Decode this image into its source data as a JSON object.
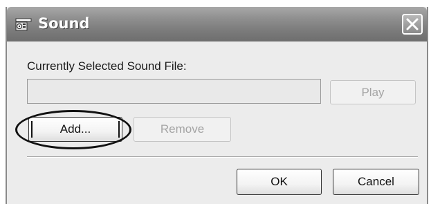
{
  "window": {
    "title": "Sound",
    "title_icon": "sound-speaker-icon",
    "close_icon": "close-icon"
  },
  "content": {
    "current_file_label": "Currently Selected Sound File:",
    "current_file_value": ""
  },
  "buttons": {
    "play": "Play",
    "add": "Add...",
    "remove": "Remove",
    "ok": "OK",
    "cancel": "Cancel"
  },
  "colors": {
    "titlebar": "#7a7a7a",
    "dialog_bg": "#ececec",
    "disabled_text": "#a4a4a4"
  }
}
